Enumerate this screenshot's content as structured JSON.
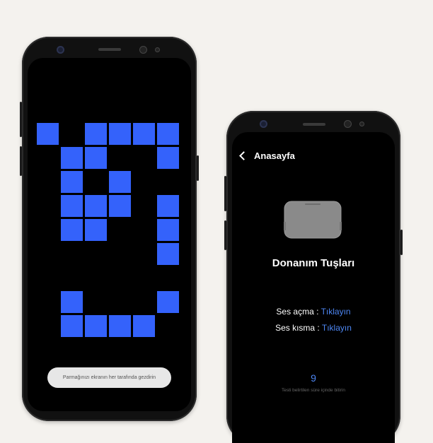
{
  "phone1": {
    "grid_cells": [
      [
        0,
        0
      ],
      [
        2,
        0
      ],
      [
        3,
        0
      ],
      [
        4,
        0
      ],
      [
        5,
        0
      ],
      [
        1,
        1
      ],
      [
        2,
        1
      ],
      [
        5,
        1
      ],
      [
        1,
        2
      ],
      [
        3,
        2
      ],
      [
        1,
        3
      ],
      [
        2,
        3
      ],
      [
        3,
        3
      ],
      [
        5,
        3
      ],
      [
        1,
        4
      ],
      [
        2,
        4
      ],
      [
        5,
        4
      ],
      [
        5,
        5
      ],
      [
        1,
        7
      ],
      [
        5,
        7
      ],
      [
        1,
        8
      ],
      [
        2,
        8
      ],
      [
        3,
        8
      ],
      [
        4,
        8
      ]
    ],
    "toast_text": "Parmağınızı ekranın her tarafında gezdirin",
    "accent_color": "#3462fb"
  },
  "phone2": {
    "nav": {
      "back_icon": "chevron-left-icon",
      "title": "Anasayfa"
    },
    "title": "Donanım Tuşları",
    "volume_up": {
      "label": "Ses açma : ",
      "action": "Tıklayın"
    },
    "volume_down": {
      "label": "Ses kısma : ",
      "action": "Tıklayın"
    },
    "countdown": "9",
    "caption": "Testi belirtilen süre içinde bitirin",
    "link_color": "#4d86f2"
  }
}
